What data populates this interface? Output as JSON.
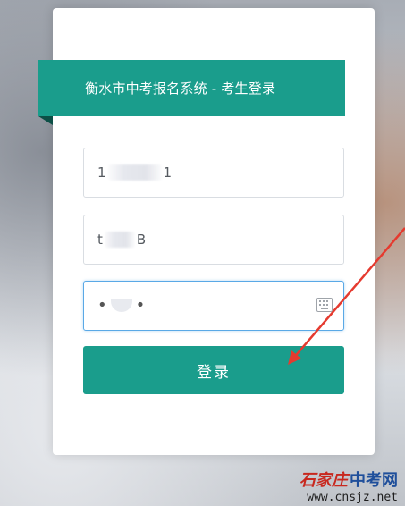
{
  "header": {
    "title": "衡水市中考报名系统 - 考生登录"
  },
  "form": {
    "field1": {
      "prefix": "1",
      "suffix": "1"
    },
    "field2": {
      "prefix": "t",
      "suffix": "B"
    },
    "password": {
      "mask": "•"
    },
    "login_label": "登录"
  },
  "watermark": {
    "brand": "石家庄",
    "site": "中考网",
    "url": "www.cnsjz.net"
  },
  "colors": {
    "accent": "#1a9d8c",
    "arrow": "#e53a2f",
    "focus_border": "#5aa9e6"
  },
  "icons": {
    "keyboard": "keyboard-icon"
  }
}
